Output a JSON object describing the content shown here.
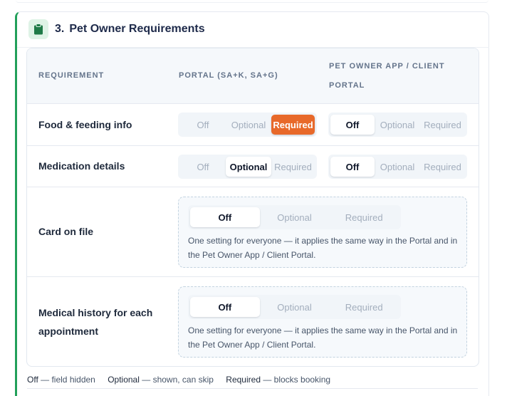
{
  "section": {
    "number": "3.",
    "title": "Pet Owner Requirements",
    "icon": "clipboard-icon",
    "accent_color": "#22a05a"
  },
  "table": {
    "headers": {
      "requirement": "REQUIREMENT",
      "portal": "PORTAL (SA+K, SA+G)",
      "app": "PET OWNER APP / CLIENT PORTAL"
    },
    "rows": [
      {
        "label": "Food & feeding info",
        "portal": {
          "options": [
            "Off",
            "Optional",
            "Required"
          ],
          "selected": "Required"
        },
        "app": {
          "options": [
            "Off",
            "Optional",
            "Required"
          ],
          "selected": "Off"
        }
      },
      {
        "label": "Medication details",
        "portal": {
          "options": [
            "Off",
            "Optional",
            "Required"
          ],
          "selected": "Optional"
        },
        "app": {
          "options": [
            "Off",
            "Optional",
            "Required"
          ],
          "selected": "Off"
        }
      },
      {
        "label": "Card on file",
        "shared": {
          "options": [
            "Off",
            "Optional",
            "Required"
          ],
          "selected": "Off"
        },
        "note": "One setting for everyone — it applies the same way in the Portal and in the Pet Owner App / Client Portal."
      },
      {
        "label": "Medical history for each appointment",
        "shared": {
          "options": [
            "Off",
            "Optional",
            "Required"
          ],
          "selected": "Off"
        },
        "note": "One setting for everyone — it applies the same way in the Portal and in the Pet Owner App / Client Portal."
      }
    ]
  },
  "legend": {
    "off_key": "Off",
    "off_desc": " — field hidden",
    "optional_key": "Optional",
    "optional_desc": " — shown, can skip",
    "required_key": "Required",
    "required_desc": " — blocks booking"
  },
  "colors": {
    "required_selected": "#e8692a",
    "header_bg": "#f5f8fb",
    "shared_box_bg": "#f6f9fc"
  }
}
